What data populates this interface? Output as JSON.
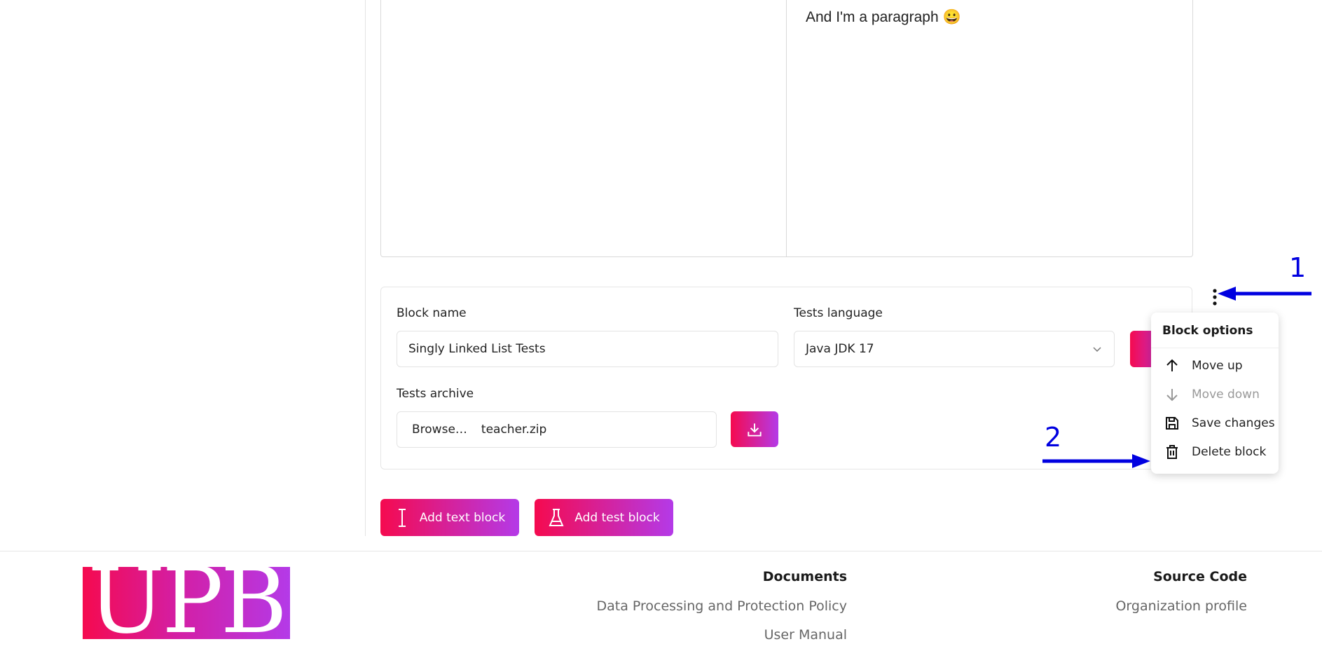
{
  "editor": {
    "paragraph": "And I'm a paragraph 😀"
  },
  "block": {
    "name_label": "Block name",
    "name_value": "Singly Linked List Tests",
    "language_label": "Tests language",
    "language_value": "Java JDK 17",
    "archive_label": "Tests archive",
    "browse_label": "Browse…",
    "file_name": "teacher.zip"
  },
  "menu": {
    "title": "Block options",
    "items": [
      {
        "label": "Move up",
        "icon": "arrow-up-icon",
        "disabled": false
      },
      {
        "label": "Move down",
        "icon": "arrow-down-icon",
        "disabled": true
      },
      {
        "label": "Save changes",
        "icon": "save-icon",
        "disabled": false
      },
      {
        "label": "Delete block",
        "icon": "trash-icon",
        "disabled": false
      }
    ]
  },
  "actions": {
    "add_text": "Add text block",
    "add_test": "Add test block"
  },
  "footer": {
    "logo_text": "UPB",
    "documents_title": "Documents",
    "documents_links": [
      "Data Processing and Protection Policy",
      "User Manual"
    ],
    "source_title": "Source Code",
    "source_links": [
      "Organization profile"
    ]
  },
  "annotations": [
    "1",
    "2"
  ],
  "colors": {
    "gradient_start": "#f50a4f",
    "gradient_end": "#b43ae8",
    "annotation": "#0000e0"
  }
}
